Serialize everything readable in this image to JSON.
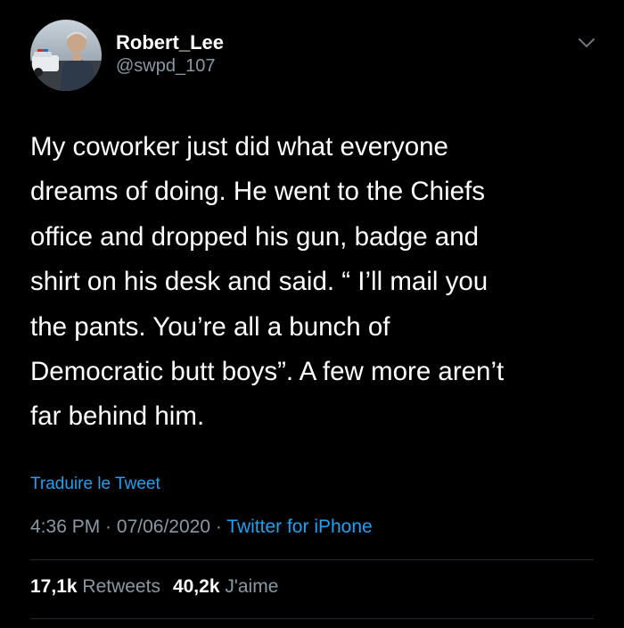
{
  "user": {
    "display_name": "Robert_Lee",
    "handle": "@swpd_107",
    "avatar_icon": "profile-photo-police-officer"
  },
  "menu_icon": "chevron-down-icon",
  "tweet": {
    "lines": [
      "My coworker just did what everyone",
      "dreams of doing. He went to the Chiefs",
      "office and dropped his gun, badge and",
      "shirt on his desk and said. “ I’ll mail you",
      "the pants. You’re all a bunch of",
      "Democratic butt boys”. A few more aren’t",
      "far behind him."
    ]
  },
  "translate_label": "Traduire le Tweet",
  "meta": {
    "time": "4:36 PM",
    "separator": " · ",
    "date": "07/06/2020",
    "source": "Twitter for iPhone"
  },
  "stats": {
    "retweets_count": "17,1k",
    "retweets_label": "Retweets",
    "likes_count": "40,2k",
    "likes_label": "J'aime"
  },
  "colors": {
    "background": "#000000",
    "text": "#ffffff",
    "secondary_text": "#8899a6",
    "link": "#1da1f2",
    "divider": "#22292f"
  }
}
